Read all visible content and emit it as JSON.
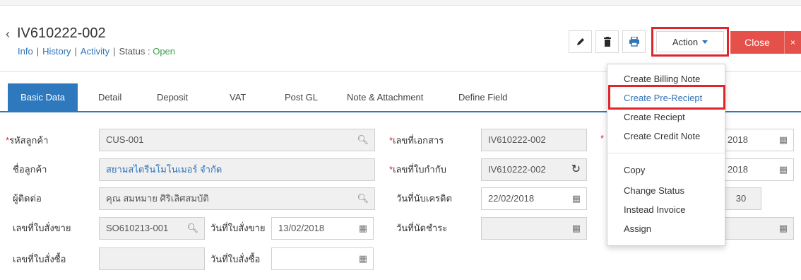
{
  "header": {
    "doc_no": "IV610222-002",
    "links": [
      "Info",
      "History",
      "Activity"
    ],
    "status_label": "Status",
    "status_colon": ":",
    "status_value": "Open"
  },
  "toolbar": {
    "edit_icon": "pencil-icon",
    "delete_icon": "trash-icon",
    "print_icon": "printer-icon",
    "action_label": "Action",
    "close_label": "Close",
    "x_label": "×"
  },
  "tabs": [
    "Basic Data",
    "Detail",
    "Deposit",
    "VAT",
    "Post GL",
    "Note & Attachment",
    "Define Field"
  ],
  "form": {
    "customer_code_label": "รหัสลูกค้า",
    "customer_code_value": "CUS-001",
    "customer_name_label": "ชื่อลูกค้า",
    "customer_name_value": "สยามสไตรีนโมโนเมอร์ จำกัด",
    "contact_label": "ผู้ติดต่อ",
    "contact_value": "คุณ สมหมาย ศิริเลิศสมบัติ",
    "so_no_label": "เลขที่ใบสั่งขาย",
    "so_no_value": "SO610213-001",
    "so_date_label": "วันที่ใบสั่งขาย",
    "so_date_value": "13/02/2018",
    "po_no_label": "เลขที่ใบสั่งซื้อ",
    "po_no_value": "",
    "po_date_label": "วันที่ใบสั่งซื้อ",
    "po_date_value": "",
    "doc_no_label": "เลขที่เอกสาร",
    "doc_no_value": "IV610222-002",
    "tax_inv_label": "เลขที่ใบกำกับ",
    "tax_inv_value": "IV610222-002",
    "credit_date_label": "วันที่นับเครดิต",
    "credit_date_value": "22/02/2018",
    "due_date_label": "วันที่นัดชำระ",
    "due_date_value": "",
    "right_col_1_value": "2018",
    "right_col_2_value": "2018",
    "right_col_3_value": "30",
    "right_col_4_value": ""
  },
  "action_menu": {
    "items_top": [
      "Create Billing Note",
      "Create Pre-Reciept",
      "Create Reciept",
      "Create Credit Note"
    ],
    "items_bottom": [
      "Copy",
      "Change Status",
      "Instead Invoice",
      "Assign"
    ],
    "highlighted": "Create Pre-Reciept"
  },
  "colors": {
    "accent": "#2e78bd",
    "close": "#e5514a",
    "highlight": "#e0242b",
    "status_open": "#3aa14e"
  }
}
